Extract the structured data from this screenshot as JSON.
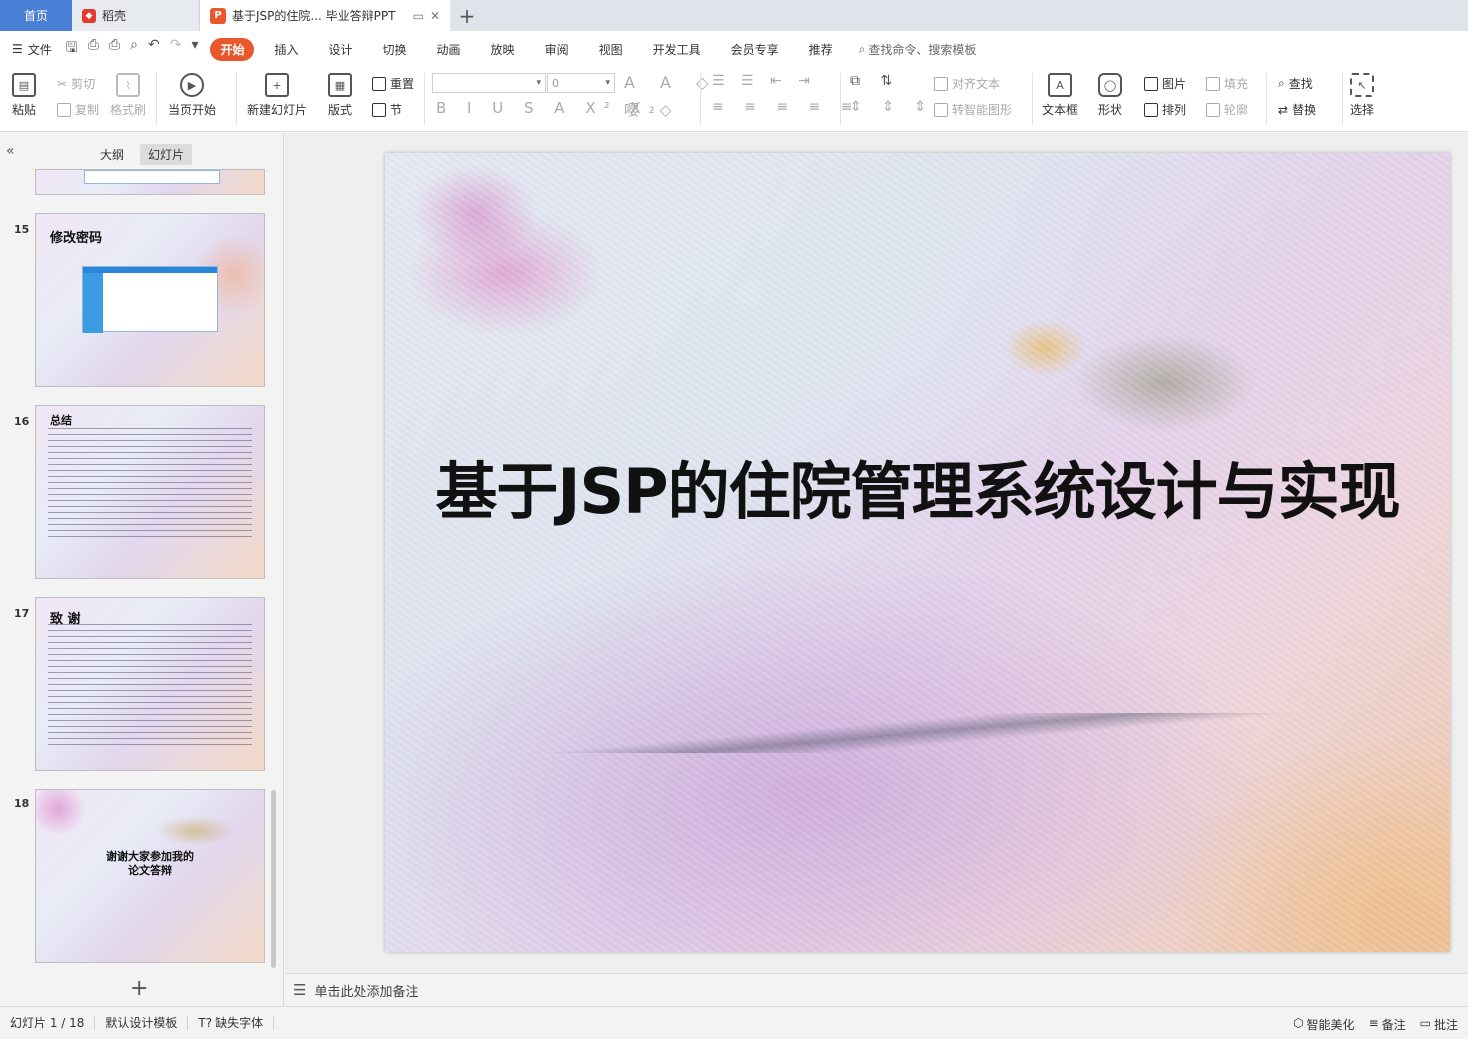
{
  "titlebar": {
    "home_tab": "首页",
    "docer_tab": "稻壳",
    "doc_tab": "基于JSP的住院... 毕业答辩PPT",
    "add_tab": "+"
  },
  "menubar": {
    "file": "文件",
    "tabs": [
      "开始",
      "插入",
      "设计",
      "切换",
      "动画",
      "放映",
      "审阅",
      "视图",
      "开发工具",
      "会员专享",
      "推荐"
    ],
    "search": "查找命令、搜索模板"
  },
  "ribbon": {
    "paste": "粘贴",
    "cut": "剪切",
    "copy": "复制",
    "format_painter": "格式刷",
    "from_current": "当页开始",
    "new_slide": "新建幻灯片",
    "layout": "版式",
    "reset": "重置",
    "section": "节",
    "font_size_value": "0",
    "align_text": "对齐文本",
    "convert_smartart": "转智能图形",
    "textbox": "文本框",
    "shapes": "形状",
    "picture": "图片",
    "arrange": "排列",
    "fill": "填充",
    "outline": "轮廓",
    "find": "查找",
    "replace": "替换",
    "select": "选择"
  },
  "leftpanel": {
    "tab_outline": "大纲",
    "tab_slides": "幻灯片",
    "thumbs": [
      {
        "num": "15",
        "title": "修改密码"
      },
      {
        "num": "16",
        "title": "总结"
      },
      {
        "num": "17",
        "title": "致   谢"
      },
      {
        "num": "18",
        "text_line1": "谢谢大家参加我的",
        "text_line2": "论文答辩"
      }
    ]
  },
  "slide": {
    "title": "基于JSP的住院管理系统设计与实现"
  },
  "notes": {
    "placeholder": "单击此处添加备注"
  },
  "statusbar": {
    "slide_counter": "幻灯片 1 / 18",
    "template": "默认设计模板",
    "missing_font": "缺失字体",
    "smart_beautify": "智能美化",
    "notes": "备注",
    "comments": "批注"
  },
  "colors": {
    "accent": "#e8582c",
    "home_tab": "#4a7fd6"
  }
}
